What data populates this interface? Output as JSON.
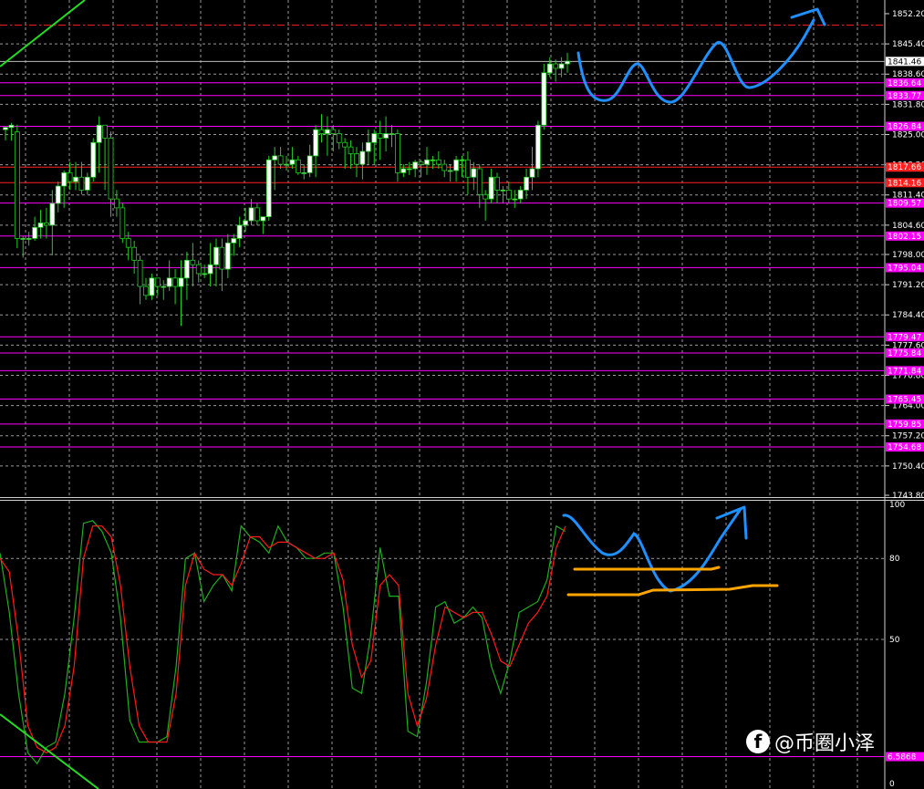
{
  "watermark": {
    "text": "@币圈小泽",
    "logo_icon": "facebook-f-icon"
  },
  "colors": {
    "background": "#000000",
    "grid": "#9a9a9a",
    "up_candle": "#ffffff",
    "down_candle": "#000000",
    "candle_line": "#22cc22",
    "level_line": "#ff00ff",
    "level_tag": "#ff00ff",
    "red_line": "#ff2020",
    "trendline": "#22dd22",
    "stoch_k": "#1fae1f",
    "stoch_d": "#ff1a1a",
    "annotation_blue": "#1e90ff",
    "annotation_orange": "#ffa500"
  },
  "chart_data": [
    {
      "type": "candlestick",
      "ylim": [
        1743.8,
        1852.2
      ],
      "y_ticks": [
        "1852.20",
        "1845.40",
        "1838.60",
        "1831.80",
        "1825.00",
        "1818.20",
        "1811.40",
        "1804.60",
        "1798.00",
        "1791.20",
        "1784.40",
        "1777.60",
        "1770.80",
        "1764.00",
        "1757.20",
        "1750.40",
        "1743.80"
      ],
      "current_price": "1841.46",
      "magenta_levels": [
        "1836.64",
        "1833.77",
        "1826.84",
        "1809.57",
        "1802.15",
        "1795.04",
        "1779.47",
        "1775.84",
        "1771.84",
        "1765.45",
        "1759.85",
        "1754.68"
      ],
      "red_levels": [
        "1817.66",
        "1814.16"
      ],
      "red_dash_level": 1849.6,
      "candles": [
        [
          1826.1,
          1826.6,
          1823.7,
          1826.8
        ],
        [
          1826.6,
          1827.1,
          1823.6,
          1827.6
        ],
        [
          1825.6,
          1801.6,
          1799.4,
          1827.2
        ],
        [
          1801.6,
          1801.6,
          1797.3,
          1802.1
        ],
        [
          1801.6,
          1801.6,
          1800.0,
          1803.1
        ],
        [
          1801.6,
          1804.1,
          1801.1,
          1806.5
        ],
        [
          1804.1,
          1805.1,
          1801.6,
          1808.0
        ],
        [
          1805.1,
          1804.6,
          1801.6,
          1808.5
        ],
        [
          1804.6,
          1809.5,
          1797.8,
          1812.5
        ],
        [
          1809.5,
          1813.4,
          1807.5,
          1814.4
        ],
        [
          1813.4,
          1816.4,
          1808.5,
          1816.9
        ],
        [
          1816.4,
          1814.4,
          1812.5,
          1818.8
        ],
        [
          1814.4,
          1815.4,
          1812.5,
          1818.8
        ],
        [
          1815.4,
          1812.5,
          1811.5,
          1818.8
        ],
        [
          1812.5,
          1815.4,
          1811.5,
          1816.4
        ],
        [
          1815.4,
          1823.2,
          1814.4,
          1824.2
        ],
        [
          1823.2,
          1827.1,
          1816.4,
          1829.1
        ],
        [
          1827.1,
          1824.2,
          1812.5,
          1826.6
        ],
        [
          1824.2,
          1810.5,
          1806.5,
          1825.7
        ],
        [
          1810.5,
          1808.5,
          1806.5,
          1812.5
        ],
        [
          1808.5,
          1801.6,
          1800.6,
          1809.5
        ],
        [
          1801.6,
          1799.6,
          1796.7,
          1803.1
        ],
        [
          1799.6,
          1796.7,
          1793.7,
          1801.1
        ],
        [
          1796.7,
          1790.8,
          1786.8,
          1797.7
        ],
        [
          1790.8,
          1788.8,
          1787.8,
          1792.7
        ],
        [
          1788.8,
          1792.7,
          1787.8,
          1793.7
        ],
        [
          1792.7,
          1790.8,
          1788.8,
          1792.7
        ],
        [
          1790.8,
          1790.8,
          1787.8,
          1792.2
        ],
        [
          1790.8,
          1792.7,
          1789.8,
          1796.7
        ],
        [
          1792.7,
          1790.8,
          1786.8,
          1794.7
        ],
        [
          1790.8,
          1792.7,
          1781.9,
          1796.7
        ],
        [
          1792.7,
          1796.7,
          1787.8,
          1798.6
        ],
        [
          1796.7,
          1795.7,
          1790.8,
          1800.6
        ],
        [
          1795.7,
          1793.7,
          1791.7,
          1796.7
        ],
        [
          1793.7,
          1793.7,
          1792.7,
          1795.7
        ],
        [
          1793.7,
          1795.7,
          1790.8,
          1800.6
        ],
        [
          1795.7,
          1799.6,
          1790.8,
          1801.6
        ],
        [
          1799.6,
          1794.7,
          1789.8,
          1801.6
        ],
        [
          1794.7,
          1800.6,
          1792.7,
          1802.6
        ],
        [
          1800.6,
          1801.6,
          1797.7,
          1802.6
        ],
        [
          1801.6,
          1804.6,
          1799.6,
          1806.5
        ],
        [
          1804.6,
          1805.6,
          1803.1,
          1808.5
        ],
        [
          1805.6,
          1808.5,
          1804.6,
          1810.5
        ],
        [
          1808.5,
          1805.6,
          1804.6,
          1809.5
        ],
        [
          1805.6,
          1806.5,
          1802.6,
          1806.5
        ],
        [
          1806.5,
          1819.3,
          1805.6,
          1820.2
        ],
        [
          1819.3,
          1820.2,
          1812.5,
          1822.2
        ],
        [
          1820.2,
          1818.3,
          1817.3,
          1822.2
        ],
        [
          1818.3,
          1818.3,
          1816.9,
          1820.2
        ],
        [
          1818.3,
          1819.3,
          1817.3,
          1822.2
        ],
        [
          1819.3,
          1816.4,
          1815.9,
          1820.2
        ],
        [
          1816.4,
          1816.4,
          1814.9,
          1818.3
        ],
        [
          1816.4,
          1820.2,
          1815.4,
          1822.7
        ],
        [
          1820.2,
          1826.1,
          1815.4,
          1827.1
        ],
        [
          1826.1,
          1825.2,
          1823.2,
          1829.6
        ],
        [
          1825.2,
          1826.1,
          1820.2,
          1829.1
        ],
        [
          1826.1,
          1825.2,
          1821.2,
          1827.1
        ],
        [
          1825.2,
          1823.2,
          1821.7,
          1826.1
        ],
        [
          1823.2,
          1822.2,
          1817.3,
          1824.2
        ],
        [
          1822.2,
          1820.7,
          1817.3,
          1823.7
        ],
        [
          1820.7,
          1818.3,
          1815.4,
          1822.2
        ],
        [
          1818.3,
          1821.2,
          1814.9,
          1823.2
        ],
        [
          1821.2,
          1823.2,
          1818.3,
          1826.1
        ],
        [
          1823.2,
          1825.2,
          1818.3,
          1826.1
        ],
        [
          1825.2,
          1824.2,
          1819.3,
          1828.1
        ],
        [
          1824.2,
          1825.2,
          1821.2,
          1829.1
        ],
        [
          1825.2,
          1825.2,
          1822.2,
          1827.1
        ],
        [
          1825.2,
          1816.4,
          1814.4,
          1826.1
        ],
        [
          1816.4,
          1817.3,
          1815.4,
          1818.3
        ],
        [
          1817.3,
          1817.3,
          1815.9,
          1818.8
        ],
        [
          1817.3,
          1818.8,
          1815.4,
          1819.3
        ],
        [
          1818.8,
          1818.3,
          1815.4,
          1819.3
        ],
        [
          1818.3,
          1819.3,
          1815.9,
          1822.2
        ],
        [
          1819.3,
          1819.3,
          1817.3,
          1820.2
        ],
        [
          1819.3,
          1818.3,
          1817.3,
          1821.2
        ],
        [
          1818.3,
          1816.9,
          1815.4,
          1819.3
        ],
        [
          1816.9,
          1816.9,
          1814.4,
          1818.3
        ],
        [
          1816.9,
          1819.3,
          1814.4,
          1820.2
        ],
        [
          1819.3,
          1819.3,
          1815.4,
          1820.2
        ],
        [
          1819.3,
          1815.4,
          1811.5,
          1821.2
        ],
        [
          1815.4,
          1817.3,
          1812.5,
          1818.8
        ],
        [
          1817.3,
          1811.5,
          1808.5,
          1818.3
        ],
        [
          1811.5,
          1810.5,
          1805.6,
          1812.5
        ],
        [
          1810.5,
          1815.4,
          1809.5,
          1817.3
        ],
        [
          1815.4,
          1812.5,
          1809.5,
          1816.4
        ],
        [
          1812.5,
          1812.5,
          1809.5,
          1813.4
        ],
        [
          1812.5,
          1810.5,
          1809.5,
          1814.4
        ],
        [
          1810.5,
          1810.5,
          1808.5,
          1812.5
        ],
        [
          1810.5,
          1812.5,
          1809.5,
          1813.4
        ],
        [
          1812.5,
          1815.4,
          1810.5,
          1817.3
        ],
        [
          1815.4,
          1817.3,
          1812.5,
          1822.2
        ],
        [
          1817.3,
          1827.1,
          1815.4,
          1828.1
        ],
        [
          1827.1,
          1838.9,
          1826.1,
          1840.9
        ],
        [
          1838.9,
          1840.9,
          1837.9,
          1842.4
        ],
        [
          1840.9,
          1839.9,
          1836.9,
          1841.9
        ],
        [
          1839.9,
          1840.9,
          1837.9,
          1842.4
        ],
        [
          1840.9,
          1841.5,
          1838.9,
          1843.4
        ]
      ]
    },
    {
      "type": "line",
      "ylim": [
        0,
        100
      ],
      "y_ticks": [
        "100",
        "80",
        "50",
        "0"
      ],
      "level_value": "6.5868",
      "series": [
        {
          "values": [
            82,
            60,
            30,
            8,
            4,
            10,
            12,
            30,
            58,
            93,
            94,
            90,
            82,
            58,
            20,
            12,
            12,
            12,
            14,
            40,
            80,
            82,
            64,
            70,
            74,
            68,
            92,
            88,
            86,
            82,
            92,
            86,
            84,
            80,
            80,
            82,
            82,
            62,
            32,
            30,
            52,
            84,
            66,
            66,
            16,
            14,
            34,
            62,
            64,
            56,
            58,
            62,
            58,
            40,
            30,
            42,
            60,
            62,
            64,
            72,
            92,
            90
          ]
        },
        {
          "values": [
            80,
            75,
            50,
            18,
            10,
            8,
            10,
            18,
            40,
            80,
            92,
            92,
            88,
            70,
            40,
            18,
            12,
            12,
            12,
            30,
            70,
            82,
            76,
            74,
            74,
            70,
            78,
            88,
            88,
            84,
            86,
            86,
            84,
            82,
            80,
            80,
            82,
            72,
            48,
            36,
            42,
            70,
            74,
            70,
            30,
            18,
            28,
            48,
            62,
            60,
            58,
            60,
            60,
            52,
            42,
            40,
            48,
            56,
            60,
            66,
            84,
            92
          ]
        }
      ]
    }
  ]
}
